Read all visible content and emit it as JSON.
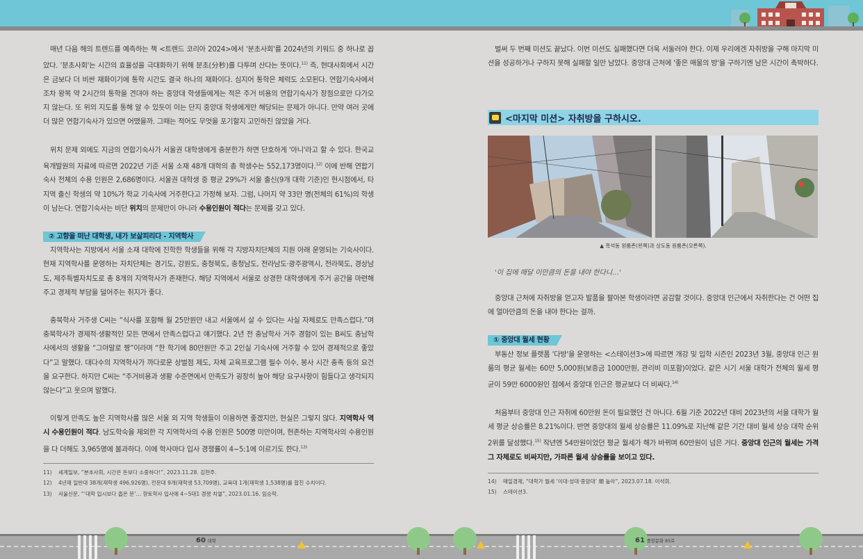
{
  "left_column": {
    "paragraphs": [
      "매년 다음 해의 트렌드를 예측하는 책 <트렌드 코리아 2024>에서 '분초사회'를 2024년의 키워드 중 하나로 꼽았다. '분초사회'는 시간의 효율성을 극대화하기 위해 분초(分秒)를 다투며 산다는 뜻이다.",
      "위치 문제 외에도 지금의 연합기숙사가 서울권 대학생에게 충분한가 하면 단호하게 '아니'라고 할 수 있다. 한국교육개발원의 자료에 따르면 2022년 기준 서울 소재 48개 대학의 총 학생수는 552,173명이다.",
      "이렇게 만족도 높은 지역학사를 많은 서울 외 지역 학생들이 이용하면 좋겠지만, 현실은 그렇지 않다."
    ],
    "p1_full": "매년 다음 해의 트렌드를 예측하는 책 <트렌드 코리아 2024>에서 '분초사회'를 2024년의 키워드 중 하나로 꼽았다. '분초사회'는 시간의 효율성을 극대화하기 위해 분초(分秒)를 다투며 산다는 뜻이다.",
    "p1_sup": "11)",
    "p1_rest": " 즉, 현대사회에서 시간은 금보다 더 비싼 재화이기에 통학 시간도 결국 하나의 재화이다. 심지어 통학은 체력도 소모된다. 연합기숙사에서조차 왕복 약 2시간의 통학을 견뎌야 하는 중앙대 학생들에게는 적은 주거 비용의 연합기숙사가 장점으로만 다가오지 않는다. 또 위의 지도를 통해 알 수 있듯이 이는 단지 중앙대 학생에게만 해당되는 문제가 아니다. 만약 여러 곳에 더 많은 연합기숙사가 있으면 어땠을까. 그때는 적어도 무엇을 포기할지 고민하진 않았을 거다.",
    "p2_start": "위치 문제 외에도 지금의 연합기숙사가 서울권 대학생에게 충분한가 하면 단호하게 '아니'라고 할 수 있다. 한국교육개발원의 자료에 따르면 2022년 기준 서울 소재 48개 대학의 총 학생수는 552,173명이다.",
    "p2_sup": "12)",
    "p2_mid": " 이에 반해 연합기숙사 전체의 수용 인원은 2,686명이다. 서울권 대학생 중 평균 29%가 서울 출신(9개 대학 기준)인 현시점에서, 타지역 출신 학생의 약 10%가 학교 기숙사에 거주한다고 가정해 보자. 그럼, 나머지 약 33만 명(전체의 61%)의 학생이 남는다. 연합기숙사는 비단 ",
    "p2_b1": "위치",
    "p2_mid2": "의 문제만이 아니라 ",
    "p2_b2": "수용인원이 적다",
    "p2_end": "는 문제를 갖고 있다.",
    "subhead": "② 고향을 떠난 대학생, 내가 보살피리다 - 지역학사",
    "p3": "지역학사는 지방에서 서울 소재 대학에 진학한 학생들을 위해 각 지방자치단체의 지원 아래 운영되는 기숙사이다. 현재 지역학사를 운영하는 자치단체는 경기도, 강원도, 충청북도, 충청남도, 전라남도·광주광역시, 전라북도, 경상남도, 제주특별자치도로 총 8개의 지역학사가 존재한다. 해당 지역에서 서울로 상경한 대학생에게 주거 공간을 마련해주고 경제적 부담을 덜어주는 취지가 좋다.",
    "p4": "충북학사 거주생 C씨는 “식사를 포함해 월 25만원만 내고 서울에서 살 수 있다는 사실 자체로도 만족스럽다.”며 충북학사가 경제적·생활적인 모든 면에서 만족스럽다고 얘기했다. 2년 전 충남학사 거주 경험이 있는 B씨도 충남학사에서의 생활을 “그야말로 짱”이라며 “한 학기에 80만원만 주고 2인실 기숙사에 거주할 수 있어 경제적으로 좋았다”고 말했다. 대다수의 지역학사가 까다로운 상벌점 제도, 자체 교육프로그램 필수 이수, 봉사 시간 충족 등의 요건을 요구한다. 하지만 C씨는 “주거비용과 생활 수준면에서 만족도가 굉장히 높아 해당 요구사항이 힘들다고 생각되지 않는다”고 웃으며 말했다.",
    "p5_start": "이렇게 만족도 높은 지역학사를 많은 서울 외 지역 학생들이 이용하면 좋겠지만, 현실은 그렇지 않다. ",
    "p5_b": "지역학사 역시 수용인원이 적다",
    "p5_end": ". 남도학숙을 제외한 각 지역학사의 수용 인원은 500명 미만이며, 현존하는 지역학사의 수용인원을 다 더해도 3,965명에 불과하다. 이에 학사마다 입사 경쟁률이 4~5:1에 이르기도 한다.",
    "p5_sup": "13)",
    "footnotes": [
      {
        "n": "11)",
        "text": "세계일보, “분초사회, 시간은 돈보다 소중하다!”, 2023.11.28. 김현주."
      },
      {
        "n": "12)",
        "text": "4년제 일반대 38개(재학생 496,926명), 전문대 9개(재학생 53,709명), 교육대 1개(재학생 1,538명)를 합친 수치이다."
      },
      {
        "n": "13)",
        "text": "서울신문, “‘대학 입시보다 좁은 문’… 향토학사 입사에 4~5대1 경쟁 치열”, 2023.01.16. 임승학."
      }
    ]
  },
  "right_column": {
    "p1": "벌써 두 번째 미션도 끝났다. 이번 미션도 실패했다면 더욱 서둘러야 한다. 이제 우리에겐 자취방을 구해 마지막 미션을 성공하거나 구하지 못해 실패할 일만 남았다. 중앙대 근처에 '좋은 매물의 방'을 구하기엔 남은 시간이 촉박하다.",
    "section_title": "<마지막 미션> 자취방을 구하시오.",
    "caption": "▲ 흑석동 원룸촌(왼쪽)과 상도동 원룸촌(오른쪽).",
    "quote": "'이 집에 매달 이만큼의 돈을 내야 한다니…'",
    "p2": "중앙대 근처에 자취방을 얻고자 발품을 팔아본 학생이라면 공감할 것이다. 중앙대 인근에서 자취한다는 건 어떤 집에 얼마만큼의 돈을 내야 한다는 걸까.",
    "subhead": "① 중앙대 월세 현황",
    "p3": "부동산 정보 플랫폼 '다방'을 운영하는 <스테이션3>에 따르면 개강 및 입학 시즌인 2023년 3월, 중앙대 인근 원룸의 평균 월세는 60만 5,000원(보증금 1000만원, 관리비 미포함)이었다. 같은 시기 서울 대학가 전체의 월세 평균이 59만 6000원인 점에서 중앙대 인근은 평균보다 더 비싸다.",
    "p3_sup": "14)",
    "p4_start": "처음부터 중앙대 인근 자취에 60만원 돈이 필요했던 건 아니다. 6월 기준 2022년 대비 2023년의 서울 대학가 월세 평균 상승률은 8.21%이다. 반면 중앙대의 월세 상승률은 11.09%로 지난해 같은 기간 대비 월세 상승 대학 순위 2위를 달성했다.",
    "p4_sup": "15)",
    "p4_mid": " 작년엔 54만원이었던 평균 월세가 해가 바뀌며 60만원이 넘은 거다. ",
    "p4_b": "중앙대 인근의 월세는 가격 그 자체로도 비싸지만, 가파른 월세 상승률을 보이고 있다.",
    "footnotes": [
      {
        "n": "14)",
        "text": "매일경제, “대학가 월세 ‘이대·성대·중앙대’ 順 높아”, 2023.07.18. 이석희."
      },
      {
        "n": "15)",
        "text": "스테이션3."
      }
    ]
  },
  "footer": {
    "left_page": "60",
    "left_label": "대학",
    "right_page": "61",
    "right_label": "중앙문화 85호"
  },
  "colors": {
    "accent": "#6ec6d6",
    "section_bar": "#8fd3e6",
    "background": "#dcdad8"
  }
}
